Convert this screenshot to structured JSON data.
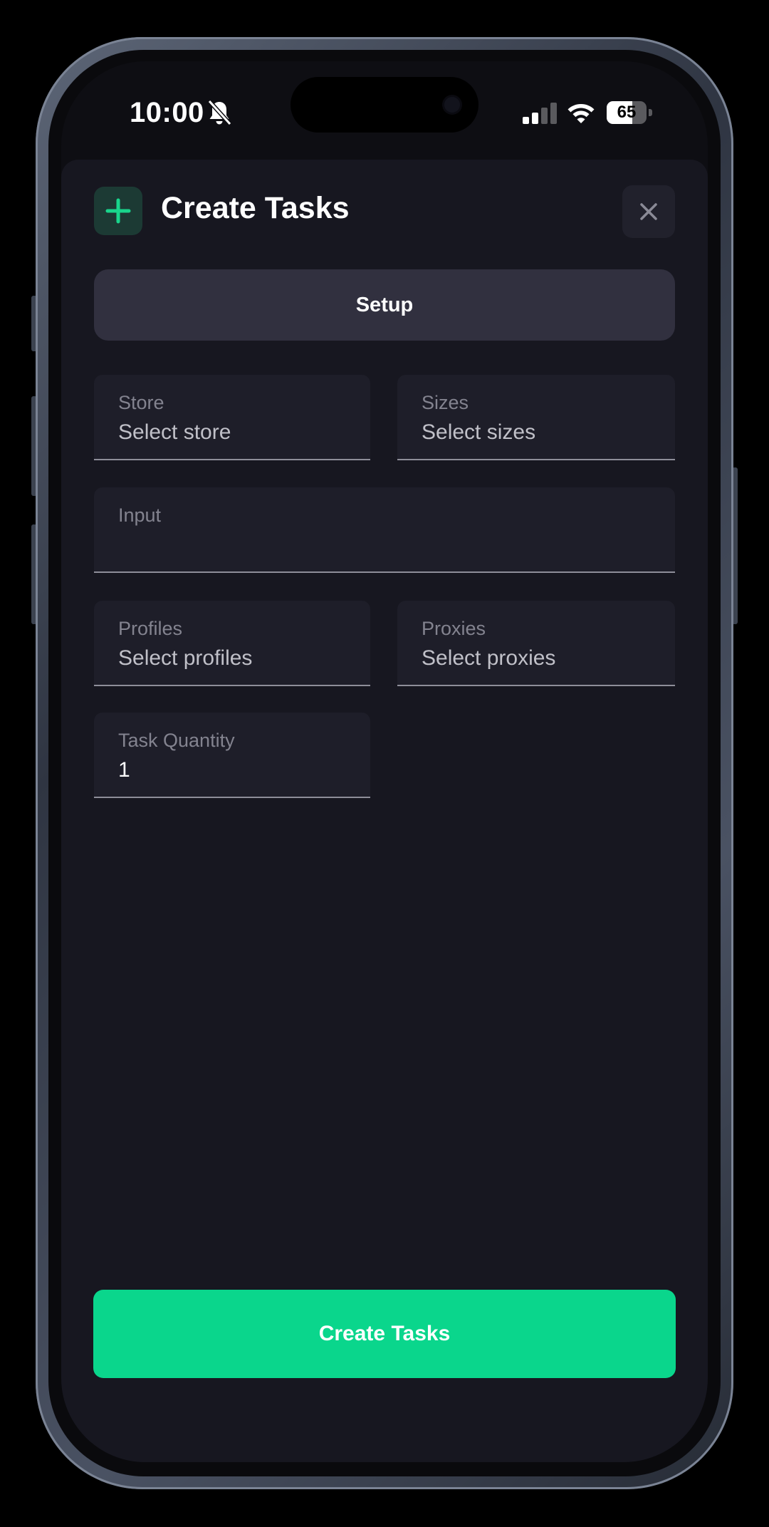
{
  "status_bar": {
    "time": "10:00",
    "battery_level": "65",
    "battery_fraction": 0.65,
    "icons": [
      "bell-slash-icon",
      "cellular-signal-icon",
      "wifi-icon",
      "battery-icon"
    ]
  },
  "header": {
    "icon": "plus-icon",
    "title": "Create Tasks",
    "close_icon": "close-icon"
  },
  "tabs": [
    {
      "label": "Setup",
      "active": true
    }
  ],
  "form": {
    "store": {
      "label": "Store",
      "value": "Select store"
    },
    "sizes": {
      "label": "Sizes",
      "value": "Select sizes"
    },
    "input": {
      "label": "Input",
      "value": ""
    },
    "profiles": {
      "label": "Profiles",
      "value": "Select profiles"
    },
    "proxies": {
      "label": "Proxies",
      "value": "Select proxies"
    },
    "quantity": {
      "label": "Task Quantity",
      "value": "1"
    }
  },
  "actions": {
    "create_label": "Create Tasks"
  },
  "colors": {
    "accent": "#0ad68c",
    "background": "#171720",
    "field": "#1e1e29",
    "tab": "#31303f"
  }
}
